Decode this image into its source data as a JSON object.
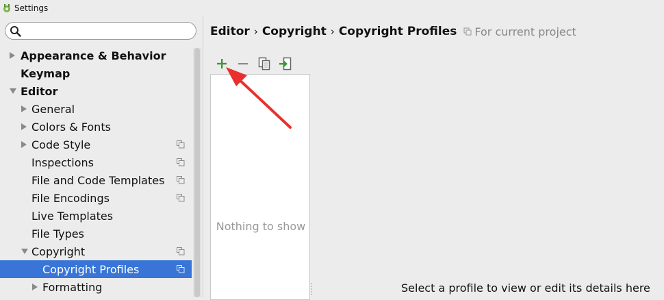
{
  "window": {
    "title": "Settings"
  },
  "search": {
    "placeholder": "",
    "value": ""
  },
  "tree": [
    {
      "label": "Appearance & Behavior",
      "bold": true,
      "expanded": false,
      "has_copy_icon": false,
      "selected": false
    },
    {
      "label": "Keymap",
      "bold": true,
      "expanded": null,
      "has_copy_icon": false,
      "selected": false
    },
    {
      "label": "Editor",
      "bold": true,
      "expanded": true,
      "has_copy_icon": false,
      "selected": false
    },
    {
      "label": "General",
      "bold": false,
      "expanded": false,
      "has_copy_icon": false,
      "selected": false
    },
    {
      "label": "Colors & Fonts",
      "bold": false,
      "expanded": false,
      "has_copy_icon": false,
      "selected": false
    },
    {
      "label": "Code Style",
      "bold": false,
      "expanded": false,
      "has_copy_icon": true,
      "selected": false
    },
    {
      "label": "Inspections",
      "bold": false,
      "expanded": null,
      "has_copy_icon": true,
      "selected": false
    },
    {
      "label": "File and Code Templates",
      "bold": false,
      "expanded": null,
      "has_copy_icon": true,
      "selected": false
    },
    {
      "label": "File Encodings",
      "bold": false,
      "expanded": null,
      "has_copy_icon": true,
      "selected": false
    },
    {
      "label": "Live Templates",
      "bold": false,
      "expanded": null,
      "has_copy_icon": false,
      "selected": false
    },
    {
      "label": "File Types",
      "bold": false,
      "expanded": null,
      "has_copy_icon": false,
      "selected": false
    },
    {
      "label": "Copyright",
      "bold": false,
      "expanded": true,
      "has_copy_icon": true,
      "selected": false
    },
    {
      "label": "Copyright Profiles",
      "bold": false,
      "expanded": null,
      "has_copy_icon": true,
      "selected": true
    },
    {
      "label": "Formatting",
      "bold": false,
      "expanded": false,
      "has_copy_icon": false,
      "selected": false
    }
  ],
  "breadcrumb": {
    "items": [
      "Editor",
      "Copyright",
      "Copyright Profiles"
    ],
    "separator": "›",
    "scope": "For current project"
  },
  "toolbar": {
    "add_icon": "plus-icon",
    "remove_icon": "minus-icon",
    "copy_icon": "copy-icon",
    "import_icon": "import-icon"
  },
  "profiles": {
    "empty_text": "Nothing to show"
  },
  "details": {
    "hint": "Select a profile to view or edit its details here"
  },
  "colors": {
    "selection": "#3875d7",
    "add_green": "#3a9a3a",
    "annotation_red": "#e8312f"
  }
}
